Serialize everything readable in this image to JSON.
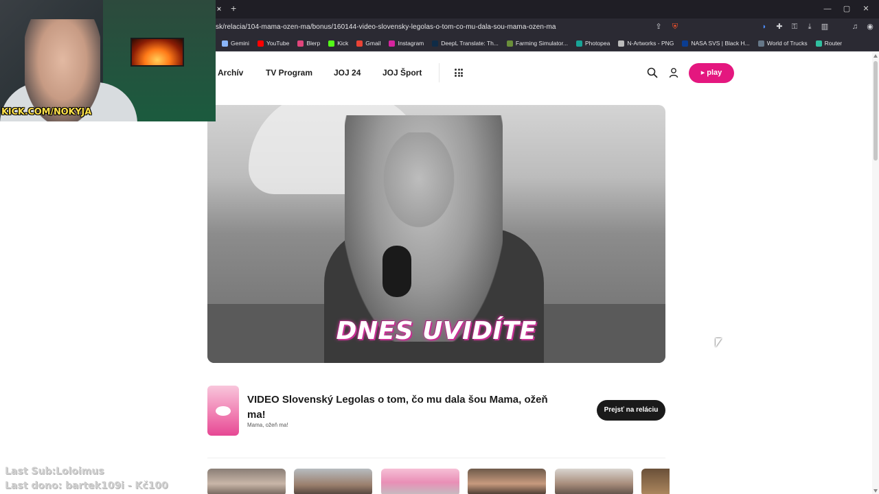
{
  "browser": {
    "url": "sk/relacia/104-mama-ozen-ma/bonus/160144-video-slovensky-legolas-o-tom-co-mu-dala-sou-mama-ozen-ma",
    "tab_close": "×",
    "tab_new": "+",
    "window_controls": [
      "—",
      "▢",
      "✕"
    ],
    "bookmarks": [
      {
        "label": "Gemini",
        "color": "#8ab4f8"
      },
      {
        "label": "YouTube",
        "color": "#ff0000"
      },
      {
        "label": "Blerp",
        "color": "#e0457b"
      },
      {
        "label": "Kick",
        "color": "#53fc18"
      },
      {
        "label": "Gmail",
        "color": "#ea4335"
      },
      {
        "label": "Instagram",
        "color": "#d6249f"
      },
      {
        "label": "DeepL Translate: Th...",
        "color": "#0f2b46"
      },
      {
        "label": "Farming Simulator...",
        "color": "#6a8f3a"
      },
      {
        "label": "Photopea",
        "color": "#18a497"
      },
      {
        "label": "N-Artworks - PNG",
        "color": "#bbbbbb"
      },
      {
        "label": "NASA SVS | Black H...",
        "color": "#0b3d91"
      },
      {
        "label": "World of Trucks",
        "color": "#667788"
      },
      {
        "label": "Router",
        "color": "#30c0a0"
      }
    ]
  },
  "webcam": {
    "label": "KICK.COM/NOKYJA"
  },
  "nav": {
    "items": [
      "Archív",
      "TV Program",
      "JOJ 24",
      "JOJ Šport"
    ],
    "play_label": "play"
  },
  "video": {
    "caption": "DNES UVIDÍTE"
  },
  "show": {
    "title": "VIDEO Slovenský Legolas o tom, čo mu dala šou Mama, ožeň ma!",
    "subtitle": "Mama, ožeň ma!",
    "goto_label": "Prejsť na reláciu"
  },
  "overlay": {
    "last_sub": "Last Sub:Loloimus",
    "last_dono": "Last dono: bartek109i - Kč100"
  },
  "colors": {
    "accent": "#e4177f",
    "chrome": "#2b2a33"
  }
}
